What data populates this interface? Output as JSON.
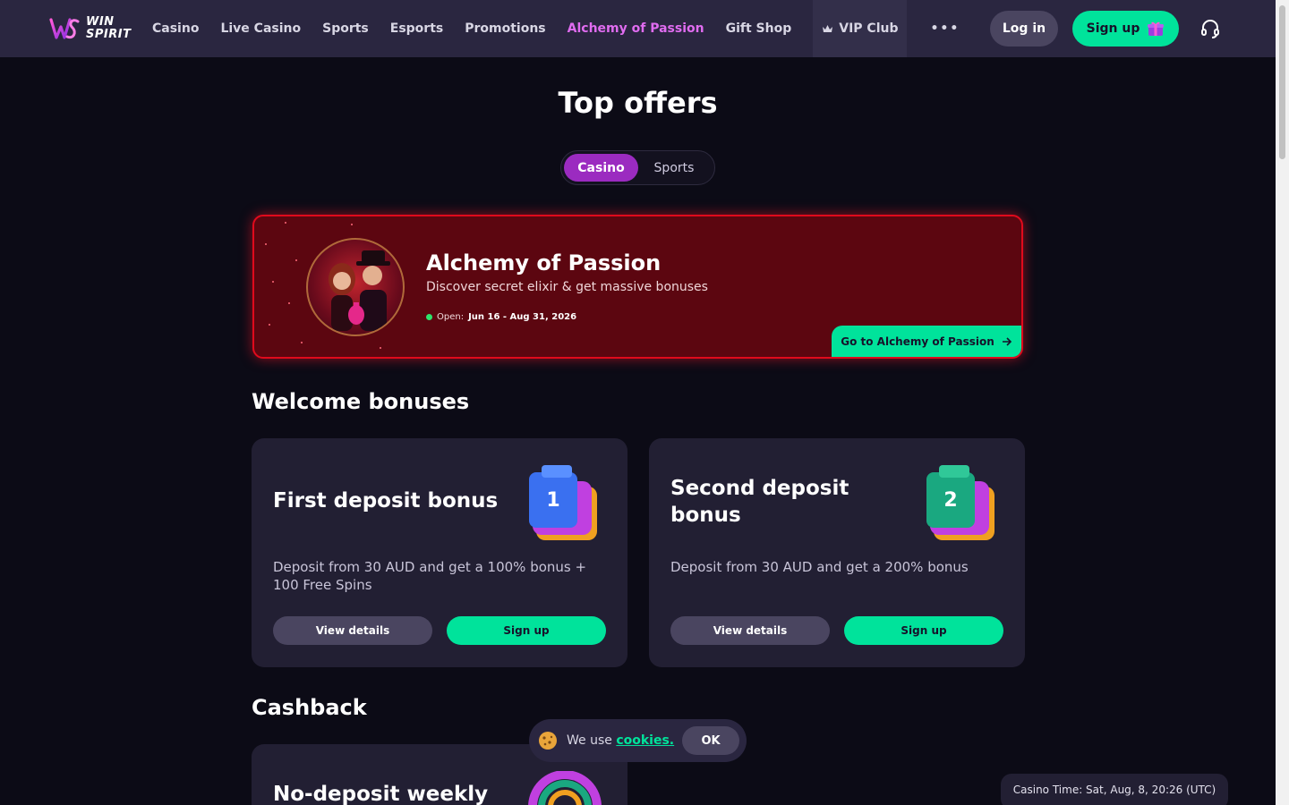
{
  "header": {
    "logo_line1": "WIN",
    "logo_line2": "SPIRIT",
    "nav": [
      {
        "label": "Casino"
      },
      {
        "label": "Live Casino"
      },
      {
        "label": "Sports"
      },
      {
        "label": "Esports"
      },
      {
        "label": "Promotions"
      },
      {
        "label": "Alchemy of Passion"
      },
      {
        "label": "Gift Shop"
      },
      {
        "label": "VIP Club"
      },
      {
        "label": "•••"
      }
    ],
    "login_label": "Log in",
    "signup_label": "Sign up",
    "accent_color": "#e06cf0",
    "cta_color": "#00e39b"
  },
  "page_title": "Top offers",
  "tabs": [
    {
      "label": "Casino",
      "active": true
    },
    {
      "label": "Sports",
      "active": false
    }
  ],
  "promo": {
    "title": "Alchemy of Passion",
    "subtitle": "Discover secret elixir & get massive bonuses",
    "open_label": "Open:",
    "open_dates": "Jun 16 - Aug 31, 2026",
    "button_label": "Go to Alchemy of Passion"
  },
  "welcome": {
    "heading": "Welcome bonuses",
    "cards": [
      {
        "title": "First deposit bonus",
        "description": "Deposit from 30 AUD and get a 100% bonus + 100 Free Spins",
        "details_label": "View details",
        "signup_label": "Sign up"
      },
      {
        "title": "Second deposit bonus",
        "description": "Deposit from 30 AUD and get a 200% bonus",
        "details_label": "View details",
        "signup_label": "Sign up"
      }
    ]
  },
  "cashback": {
    "heading": "Cashback",
    "cards": [
      {
        "title": "No-deposit weekly"
      }
    ]
  },
  "cookie": {
    "text": "We use",
    "link": "cookies.",
    "ok_label": "OK"
  },
  "casino_time": "Casino Time: Sat, Aug, 8, 20:26 (UTC)"
}
